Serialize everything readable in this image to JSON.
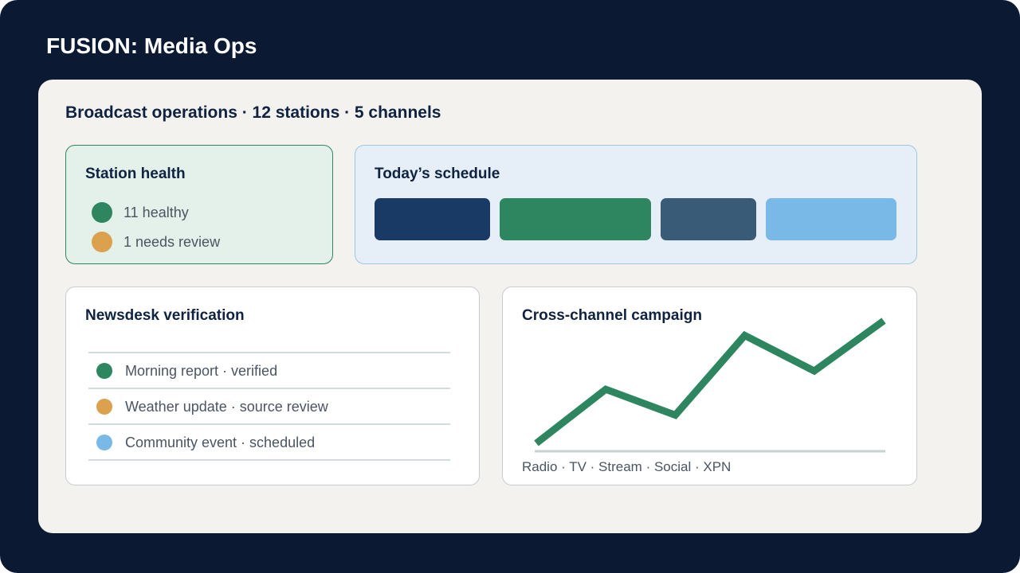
{
  "app": {
    "title": "FUSION: Media Ops"
  },
  "summary": "Broadcast operations · 12 stations · 5 channels",
  "station_health": {
    "title": "Station health",
    "items": [
      {
        "label": "11 healthy",
        "color": "#2d8660"
      },
      {
        "label": "1 needs review",
        "color": "#dba14e"
      }
    ]
  },
  "schedule": {
    "title": "Today’s schedule",
    "slot_colors": [
      "#1a3a66",
      "#2d8660",
      "#3a5b78",
      "#78b9e8"
    ]
  },
  "newsdesk": {
    "title": "Newsdesk verification",
    "items": [
      {
        "label": "Morning report · verified",
        "color": "#2d8660"
      },
      {
        "label": "Weather update · source review",
        "color": "#dba14e"
      },
      {
        "label": "Community event · scheduled",
        "color": "#78b9e8"
      }
    ]
  },
  "campaign": {
    "title": "Cross-channel campaign",
    "x_labels": "Radio · TV · Stream · Social · XPN",
    "line_color": "#2d8660",
    "values": [
      0,
      0.44,
      0.23,
      0.88,
      0.59,
      1.0
    ]
  }
}
